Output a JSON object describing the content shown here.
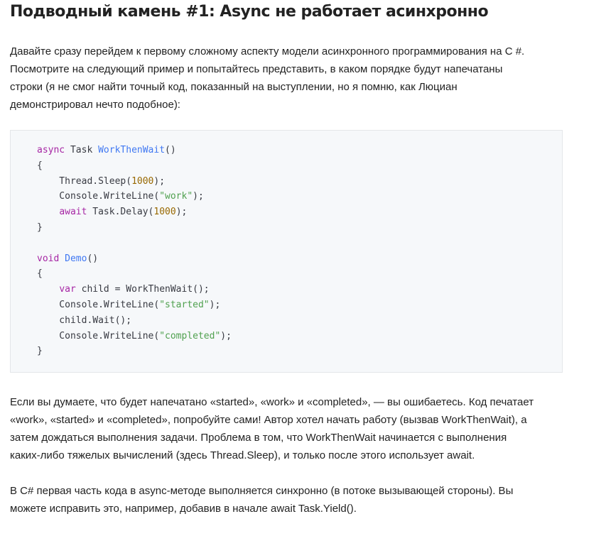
{
  "article": {
    "title": "Подводный камень #1: Async не работает асинхронно",
    "intro_lines": [
      "Давайте сразу перейдем к первому сложному аспекту модели асинхронного программирования на C #.",
      "Посмотрите на следующий пример и попытайтесь представить, в каком порядке будут напечатаны",
      "строки (я не смог найти точный код, показанный на выступлении, но я помню, как Люциан",
      "демонстрировал нечто подобное):"
    ],
    "code_lines": [
      [
        [
          "kw",
          "async"
        ],
        [
          "pl",
          " Task "
        ],
        [
          "fn",
          "WorkThenWait"
        ],
        [
          "pl",
          "()"
        ]
      ],
      [
        [
          "pl",
          "{"
        ]
      ],
      [
        [
          "pl",
          "    Thread.Sleep("
        ],
        [
          "num",
          "1000"
        ],
        [
          "pl",
          ");"
        ]
      ],
      [
        [
          "pl",
          "    Console.WriteLine("
        ],
        [
          "str",
          "\"work\""
        ],
        [
          "pl",
          ");"
        ]
      ],
      [
        [
          "pl",
          "    "
        ],
        [
          "kw",
          "await"
        ],
        [
          "pl",
          " Task.Delay("
        ],
        [
          "num",
          "1000"
        ],
        [
          "pl",
          ");"
        ]
      ],
      [
        [
          "pl",
          "}"
        ]
      ],
      [],
      [
        [
          "kw",
          "void"
        ],
        [
          "pl",
          " "
        ],
        [
          "fn",
          "Demo"
        ],
        [
          "pl",
          "()"
        ]
      ],
      [
        [
          "pl",
          "{"
        ]
      ],
      [
        [
          "pl",
          "    "
        ],
        [
          "kw",
          "var"
        ],
        [
          "pl",
          " child = WorkThenWait();"
        ]
      ],
      [
        [
          "pl",
          "    Console.WriteLine("
        ],
        [
          "str",
          "\"started\""
        ],
        [
          "pl",
          ");"
        ]
      ],
      [
        [
          "pl",
          "    child.Wait();"
        ]
      ],
      [
        [
          "pl",
          "    Console.WriteLine("
        ],
        [
          "str",
          "\"completed\""
        ],
        [
          "pl",
          ");"
        ]
      ],
      [
        [
          "pl",
          "}"
        ]
      ]
    ],
    "explanation_lines": [
      "Если вы думаете, что будет напечатано «started», «work» и «completed», — вы ошибаетесь. Код печатает",
      "«work», «started» и «completed», попробуйте сами! Автор хотел начать работу (вызвав WorkThenWait), а",
      "затем дождаться выполнения задачи. Проблема в том, что WorkThenWait начинается с выполнения",
      "каких-либо тяжелых вычислений (здесь Thread.Sleep), и только после этого использует await."
    ],
    "conclusion_lines": [
      "В C# первая часть кода в async-методе выполняется синхронно (в потоке вызывающей стороны). Вы",
      "можете исправить это, например, добавив в начале await Task.Yield()."
    ]
  },
  "colors": {
    "keyword": "#a626a4",
    "function": "#4078f2",
    "number": "#986801",
    "string": "#50a14f",
    "code_background": "#f6f8fa"
  }
}
